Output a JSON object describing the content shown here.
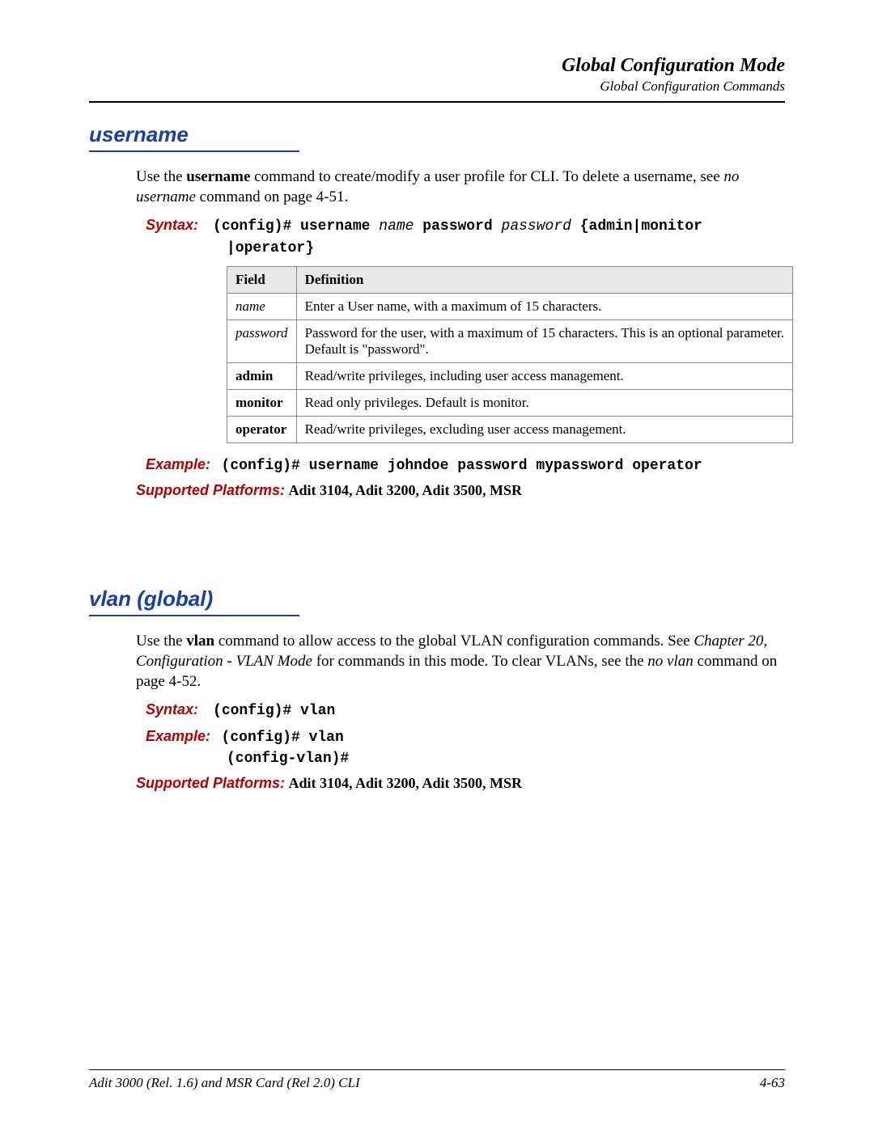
{
  "header": {
    "title": "Global Configuration Mode",
    "subtitle": "Global Configuration Commands"
  },
  "section1": {
    "heading": "username",
    "intro_pre": "Use the ",
    "intro_bold": "username",
    "intro_mid": " command to create/modify a user profile for CLI. To delete a username, see ",
    "intro_it": "no username",
    "intro_post": " command on page 4-51.",
    "syntax_label": "Syntax:",
    "syntax_1": "(config)# username ",
    "syntax_name": "name",
    "syntax_2": " password ",
    "syntax_password": "password",
    "syntax_3": " {admin|monitor |operator}",
    "table": {
      "head_field": "Field",
      "head_def": "Definition",
      "rows": [
        {
          "field": "name",
          "style": "italic",
          "def": "Enter a User name, with a maximum of 15 characters."
        },
        {
          "field": "password",
          "style": "italic",
          "def": "Password for the user, with a maximum of 15 characters. This is an optional parameter. Default is \"password\"."
        },
        {
          "field": "admin",
          "style": "bold",
          "def": "Read/write privileges, including user access management."
        },
        {
          "field": "monitor",
          "style": "bold",
          "def": "Read only privileges. Default is monitor."
        },
        {
          "field": "operator",
          "style": "bold",
          "def": "Read/write privileges, excluding user access management."
        }
      ]
    },
    "example_label": "Example:",
    "example_text": "(config)# username johndoe password mypassword operator",
    "platforms_label": "Supported Platforms:",
    "platforms_text": " Adit 3104, Adit 3200, Adit 3500, MSR"
  },
  "section2": {
    "heading": "vlan (global)",
    "intro_pre": "Use the ",
    "intro_bold": "vlan",
    "intro_mid": " command to allow access to the global VLAN configuration commands. See ",
    "intro_it1": "Chapter 20, Configuration - VLAN Mode",
    "intro_mid2": " for commands in this mode. To clear VLANs, see the ",
    "intro_it2": "no vlan",
    "intro_post": " command on page 4-52.",
    "syntax_label": "Syntax:",
    "syntax_text": "(config)# vlan",
    "example_label": "Example:",
    "example_line1": "(config)# vlan",
    "example_line2": "(config-vlan)#",
    "platforms_label": "Supported Platforms:",
    "platforms_text": " Adit 3104, Adit 3200, Adit 3500, MSR"
  },
  "footer": {
    "left": "Adit 3000 (Rel. 1.6) and MSR Card (Rel 2.0) CLI",
    "right": "4-63"
  }
}
